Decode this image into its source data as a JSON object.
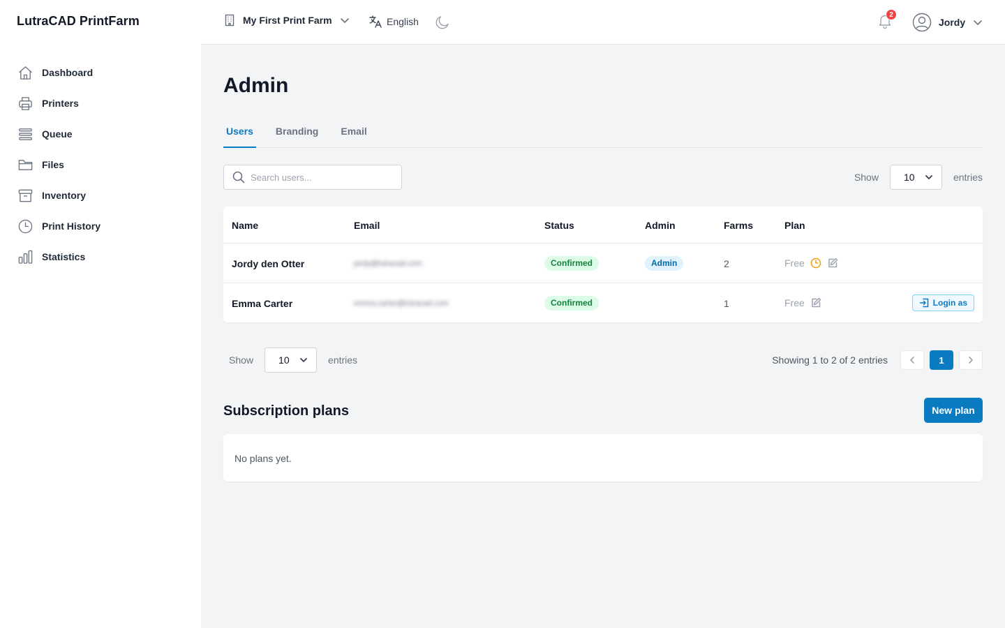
{
  "app": {
    "brand": "LutraCAD PrintFarm"
  },
  "sidebar": {
    "items": [
      {
        "label": "Dashboard",
        "icon": "home-icon"
      },
      {
        "label": "Printers",
        "icon": "printer-icon"
      },
      {
        "label": "Queue",
        "icon": "queue-icon"
      },
      {
        "label": "Files",
        "icon": "folder-icon"
      },
      {
        "label": "Inventory",
        "icon": "archive-icon"
      },
      {
        "label": "Print History",
        "icon": "clock-icon"
      },
      {
        "label": "Statistics",
        "icon": "bar-chart-icon"
      }
    ]
  },
  "header": {
    "farm": "My First Print Farm",
    "language": "English",
    "notifications_count": "2",
    "user": "Jordy"
  },
  "page": {
    "title": "Admin"
  },
  "tabs": [
    {
      "label": "Users",
      "active": true
    },
    {
      "label": "Branding",
      "active": false
    },
    {
      "label": "Email",
      "active": false
    }
  ],
  "users": {
    "search_placeholder": "Search users...",
    "show_label": "Show",
    "entries_label": "entries",
    "page_size": "10",
    "columns": [
      "Name",
      "Email",
      "Status",
      "Admin",
      "Farms",
      "Plan"
    ],
    "rows": [
      {
        "name": "Jordy den Otter",
        "email": "jordy@lutracad.com",
        "status": "Confirmed",
        "admin": "Admin",
        "farms": "2",
        "plan": "Free",
        "has_login_as": false
      },
      {
        "name": "Emma Carter",
        "email": "emma.carter@lutracad.com",
        "status": "Confirmed",
        "admin": "",
        "farms": "1",
        "plan": "Free",
        "has_login_as": true
      }
    ],
    "login_as_label": "Login as",
    "showing_text": "Showing 1 to 2 of 2 entries",
    "current_page": "1"
  },
  "subscription": {
    "title": "Subscription plans",
    "new_plan_label": "New plan",
    "empty_text": "No plans yet."
  },
  "colors": {
    "accent": "#0b7bc1",
    "confirmed_bg": "#dcfce7",
    "confirmed_text": "#15803d",
    "admin_bg": "#e0f2fe",
    "admin_text": "#0369a1",
    "notification": "#ef4444",
    "warning_icon": "#f59e0b"
  }
}
